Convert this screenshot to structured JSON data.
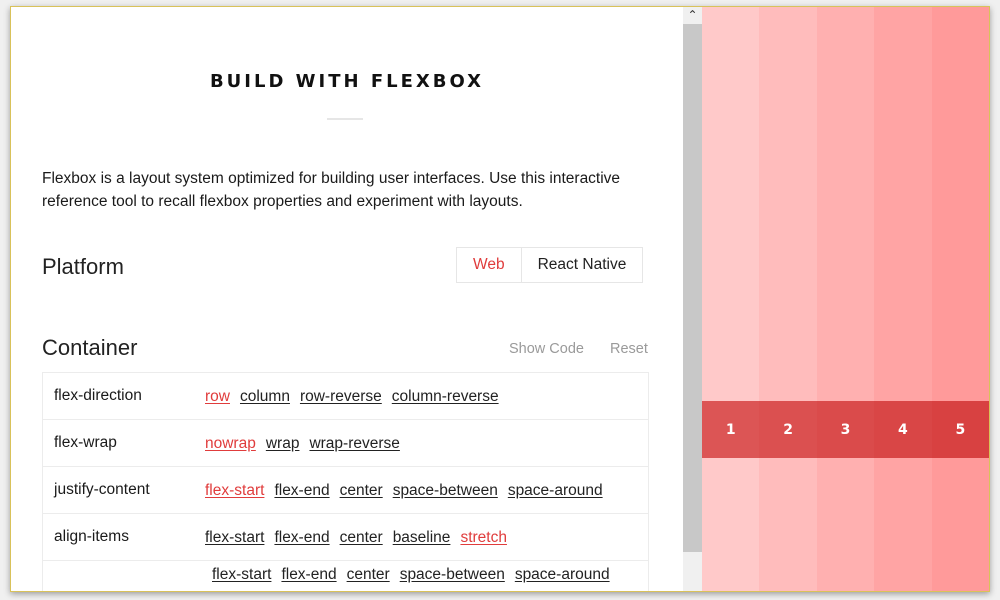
{
  "header": {
    "title": "BUILD WITH FLEXBOX",
    "intro": "Flexbox is a layout system optimized for building user interfaces. Use this interactive reference tool to recall flexbox properties and experiment with layouts."
  },
  "platform": {
    "label": "Platform",
    "options": [
      {
        "label": "Web",
        "active": true
      },
      {
        "label": "React Native",
        "active": false
      }
    ]
  },
  "container": {
    "label": "Container",
    "show_code_label": "Show Code",
    "reset_label": "Reset",
    "properties": [
      {
        "name": "flex-direction",
        "values": [
          "row",
          "column",
          "row-reverse",
          "column-reverse"
        ],
        "selected": "row"
      },
      {
        "name": "flex-wrap",
        "values": [
          "nowrap",
          "wrap",
          "wrap-reverse"
        ],
        "selected": "nowrap"
      },
      {
        "name": "justify-content",
        "values": [
          "flex-start",
          "flex-end",
          "center",
          "space-between",
          "space-around"
        ],
        "selected": "flex-start"
      },
      {
        "name": "align-items",
        "values": [
          "flex-start",
          "flex-end",
          "center",
          "baseline",
          "stretch"
        ],
        "selected": "stretch"
      },
      {
        "name": "",
        "values": [
          "flex-start",
          "flex-end",
          "center",
          "space-between",
          "space-around"
        ],
        "selected": ""
      }
    ]
  },
  "scrollbar": {
    "up_icon": "chevron-up-icon"
  },
  "preview": {
    "background_colors": [
      "#ffc9c9",
      "#ffbcbc",
      "#ffb0b0",
      "#ffa4a4",
      "#ff9a9a"
    ],
    "items": [
      {
        "label": "1",
        "color": "#dc5555"
      },
      {
        "label": "2",
        "color": "#db5050"
      },
      {
        "label": "3",
        "color": "#da4b4b"
      },
      {
        "label": "4",
        "color": "#d94646"
      },
      {
        "label": "5",
        "color": "#d84141"
      }
    ]
  },
  "colors": {
    "accent": "#e03c3c"
  }
}
